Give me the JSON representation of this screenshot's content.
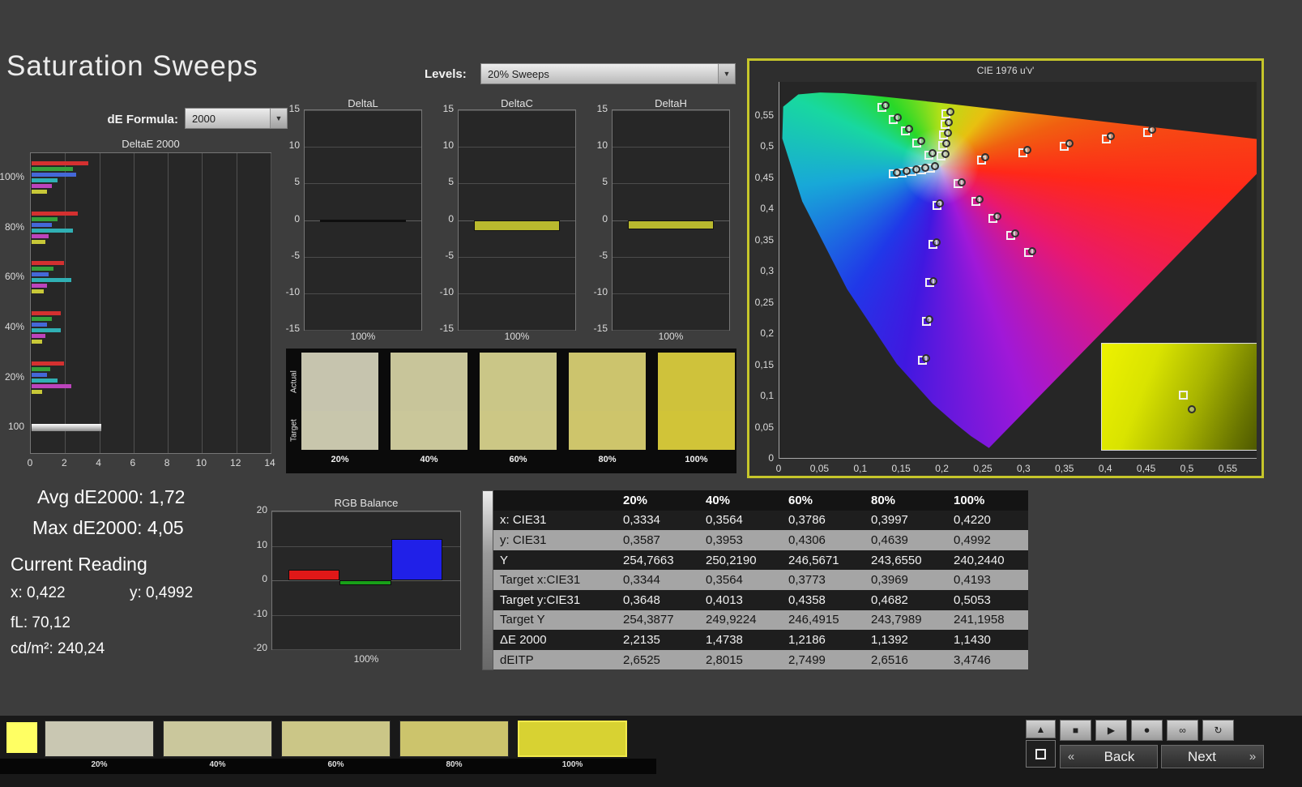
{
  "title": "Saturation Sweeps",
  "controls": {
    "de_formula_label": "dE Formula:",
    "de_formula_value": "2000",
    "levels_label": "Levels:",
    "levels_value": "20% Sweeps"
  },
  "stats": {
    "avg": "Avg dE2000: 1,72",
    "max": "Max dE2000: 4,05",
    "current_title": "Current Reading",
    "x": "x: 0,422",
    "y": "y: 0,4992",
    "fl": "fL: 70,12",
    "cd": "cd/m²: 240,24"
  },
  "saturation_swatches": {
    "actual_label": "Actual",
    "target_label": "Target",
    "items": [
      {
        "label": "20%",
        "actual": "#c6c4ae",
        "target": "#c8c6ac"
      },
      {
        "label": "40%",
        "actual": "#c8c59a",
        "target": "#cac79a"
      },
      {
        "label": "60%",
        "actual": "#cac687",
        "target": "#ccc785"
      },
      {
        "label": "80%",
        "actual": "#ccc46d",
        "target": "#cec56b"
      },
      {
        "label": "100%",
        "actual": "#cfc23b",
        "target": "#d1c438"
      }
    ]
  },
  "bottom_bar": {
    "patch_color": "#ffff63",
    "swatches": [
      {
        "label": "20%",
        "color": "#c9c7b2",
        "selected": false
      },
      {
        "label": "40%",
        "color": "#cac79c",
        "selected": false
      },
      {
        "label": "60%",
        "color": "#cbc687",
        "selected": false
      },
      {
        "label": "80%",
        "color": "#ccc46c",
        "selected": false
      },
      {
        "label": "100%",
        "color": "#d8d232",
        "selected": true
      }
    ],
    "back_label": "Back",
    "next_label": "Next"
  },
  "icons": {
    "dropdown": "▼",
    "back": "«",
    "next": "»",
    "stop": "■",
    "play": "▶",
    "record": "⏺",
    "loop": "∞",
    "refresh": "↻",
    "up": "▲"
  },
  "chart_data": [
    {
      "type": "bar",
      "id": "deltae",
      "title": "DeltaE 2000",
      "xlabel": "",
      "ylabel": "",
      "xlim": [
        0,
        14
      ],
      "xticks": [
        0,
        2,
        4,
        6,
        8,
        10,
        12,
        14
      ],
      "palette": [
        "#d43030",
        "#36a03a",
        "#4468d8",
        "#30b0b4",
        "#bc44bc",
        "#c8c838"
      ],
      "groups": [
        {
          "label": "100%",
          "values": [
            3.3,
            2.4,
            2.6,
            1.5,
            1.2,
            0.9
          ]
        },
        {
          "label": "80%",
          "values": [
            2.7,
            1.5,
            1.2,
            2.4,
            1.0,
            0.8
          ]
        },
        {
          "label": "60%",
          "values": [
            1.9,
            1.3,
            1.0,
            2.3,
            0.9,
            0.7
          ]
        },
        {
          "label": "40%",
          "values": [
            1.7,
            1.2,
            0.9,
            1.7,
            0.8,
            0.6
          ]
        },
        {
          "label": "20%",
          "values": [
            1.9,
            1.1,
            0.9,
            1.5,
            2.3,
            0.6
          ]
        },
        {
          "label": "100",
          "values": [
            4.05
          ],
          "gradient": true
        }
      ]
    },
    {
      "type": "bar",
      "id": "deltal",
      "title": "DeltaL",
      "ylim": [
        -15,
        15
      ],
      "yticks": [
        15,
        10,
        5,
        0,
        -5,
        -10,
        -15
      ],
      "categories": [
        "100%"
      ],
      "values": [
        0
      ],
      "bar_color": "#b9b92e"
    },
    {
      "type": "bar",
      "id": "deltac",
      "title": "DeltaC",
      "ylim": [
        -15,
        15
      ],
      "yticks": [
        15,
        10,
        5,
        0,
        -5,
        -10,
        -15
      ],
      "categories": [
        "100%"
      ],
      "values": [
        -1.5
      ],
      "bar_color": "#b9b92e"
    },
    {
      "type": "bar",
      "id": "deltah",
      "title": "DeltaH",
      "ylim": [
        -15,
        15
      ],
      "yticks": [
        15,
        10,
        5,
        0,
        -5,
        -10,
        -15
      ],
      "categories": [
        "100%"
      ],
      "values": [
        -1.3
      ],
      "bar_color": "#b9b92e"
    },
    {
      "type": "bar",
      "id": "rgb",
      "title": "RGB Balance",
      "ylim": [
        -20,
        20
      ],
      "yticks": [
        20,
        10,
        0,
        -10,
        -20
      ],
      "categories": [
        "100%"
      ],
      "series": [
        {
          "name": "Red",
          "color": "#e01818",
          "value": 3
        },
        {
          "name": "Green",
          "color": "#18a018",
          "value": -1.5
        },
        {
          "name": "Blue",
          "color": "#2020e8",
          "value": 12
        }
      ]
    },
    {
      "type": "scatter",
      "id": "cie",
      "title": "CIE 1976 u'v'",
      "xticks": [
        "0",
        "0,05",
        "0,1",
        "0,15",
        "0,2",
        "0,25",
        "0,3",
        "0,35",
        "0,4",
        "0,45",
        "0,5",
        "0,55"
      ],
      "yticks": [
        "0",
        "0,05",
        "0,1",
        "0,15",
        "0,2",
        "0,25",
        "0,3",
        "0,35",
        "0,4",
        "0,45",
        "0,5",
        "0,55"
      ],
      "white_point": [
        0.197,
        0.468
      ],
      "locus": [
        [
          0.257,
          0.016
        ],
        [
          0.235,
          0.035
        ],
        [
          0.216,
          0.055
        ],
        [
          0.188,
          0.087
        ],
        [
          0.144,
          0.151
        ],
        [
          0.083,
          0.271
        ],
        [
          0.028,
          0.412
        ],
        [
          0.0035,
          0.513
        ],
        [
          0.0046,
          0.564
        ],
        [
          0.0231,
          0.5837
        ],
        [
          0.05,
          0.5868
        ],
        [
          0.079,
          0.5856
        ],
        [
          0.113,
          0.5821
        ],
        [
          0.153,
          0.5766
        ],
        [
          0.203,
          0.5694
        ],
        [
          0.262,
          0.5604
        ],
        [
          0.332,
          0.5501
        ],
        [
          0.403,
          0.5393
        ],
        [
          0.52,
          0.5219
        ],
        [
          0.623,
          0.5065
        ]
      ],
      "targets": [
        [
          0.2477,
          0.479
        ],
        [
          0.2985,
          0.49
        ],
        [
          0.3492,
          0.5009
        ],
        [
          0.4,
          0.5119
        ],
        [
          0.4507,
          0.5229
        ],
        [
          0.1826,
          0.4869
        ],
        [
          0.1682,
          0.5058
        ],
        [
          0.1538,
          0.5247
        ],
        [
          0.1394,
          0.5436
        ],
        [
          0.125,
          0.5625
        ],
        [
          0.1927,
          0.406
        ],
        [
          0.1884,
          0.344
        ],
        [
          0.184,
          0.2819
        ],
        [
          0.1797,
          0.2199
        ],
        [
          0.1754,
          0.1579
        ],
        [
          0.1984,
          0.485
        ],
        [
          0.1998,
          0.502
        ],
        [
          0.2012,
          0.519
        ],
        [
          0.2026,
          0.536
        ],
        [
          0.204,
          0.553
        ],
        [
          0.1854,
          0.4656
        ],
        [
          0.1738,
          0.4632
        ],
        [
          0.1622,
          0.4608
        ],
        [
          0.1506,
          0.4584
        ],
        [
          0.139,
          0.456
        ],
        [
          0.2186,
          0.4404
        ],
        [
          0.2402,
          0.4128
        ],
        [
          0.2618,
          0.3852
        ],
        [
          0.2834,
          0.3576
        ],
        [
          0.305,
          0.33
        ]
      ],
      "measured": [
        [
          0.2517,
          0.483
        ],
        [
          0.3035,
          0.4945
        ],
        [
          0.3552,
          0.5055
        ],
        [
          0.406,
          0.5165
        ],
        [
          0.4567,
          0.527
        ],
        [
          0.1876,
          0.49
        ],
        [
          0.1732,
          0.509
        ],
        [
          0.1588,
          0.528
        ],
        [
          0.1444,
          0.547
        ],
        [
          0.13,
          0.566
        ],
        [
          0.1967,
          0.409
        ],
        [
          0.1924,
          0.347
        ],
        [
          0.188,
          0.285
        ],
        [
          0.1837,
          0.223
        ],
        [
          0.1794,
          0.161
        ],
        [
          0.2034,
          0.488
        ],
        [
          0.2048,
          0.505
        ],
        [
          0.2062,
          0.522
        ],
        [
          0.2076,
          0.539
        ],
        [
          0.209,
          0.556
        ],
        [
          0.1904,
          0.4686
        ],
        [
          0.1788,
          0.4662
        ],
        [
          0.1672,
          0.4638
        ],
        [
          0.1556,
          0.4614
        ],
        [
          0.144,
          0.459
        ],
        [
          0.2236,
          0.4434
        ],
        [
          0.2452,
          0.4158
        ],
        [
          0.2668,
          0.3882
        ],
        [
          0.2884,
          0.3606
        ],
        [
          0.31,
          0.333
        ]
      ]
    },
    {
      "type": "table",
      "id": "measurements",
      "columns": [
        "20%",
        "40%",
        "60%",
        "80%",
        "100%"
      ],
      "rows": [
        {
          "label": "x: CIE31",
          "values": [
            "0,3334",
            "0,3564",
            "0,3786",
            "0,3997",
            "0,4220"
          ]
        },
        {
          "label": "y: CIE31",
          "values": [
            "0,3587",
            "0,3953",
            "0,4306",
            "0,4639",
            "0,4992"
          ]
        },
        {
          "label": "Y",
          "values": [
            "254,7663",
            "250,2190",
            "246,5671",
            "243,6550",
            "240,2440"
          ]
        },
        {
          "label": "Target x:CIE31",
          "values": [
            "0,3344",
            "0,3564",
            "0,3773",
            "0,3969",
            "0,4193"
          ]
        },
        {
          "label": "Target y:CIE31",
          "values": [
            "0,3648",
            "0,4013",
            "0,4358",
            "0,4682",
            "0,5053"
          ]
        },
        {
          "label": "Target Y",
          "values": [
            "254,3877",
            "249,9224",
            "246,4915",
            "243,7989",
            "241,1958"
          ]
        },
        {
          "label": "ΔE 2000",
          "values": [
            "2,2135",
            "1,4738",
            "1,2186",
            "1,1392",
            "1,1430"
          ]
        },
        {
          "label": "dEITP",
          "values": [
            "2,6525",
            "2,8015",
            "2,7499",
            "2,6516",
            "3,4746"
          ]
        }
      ]
    }
  ]
}
